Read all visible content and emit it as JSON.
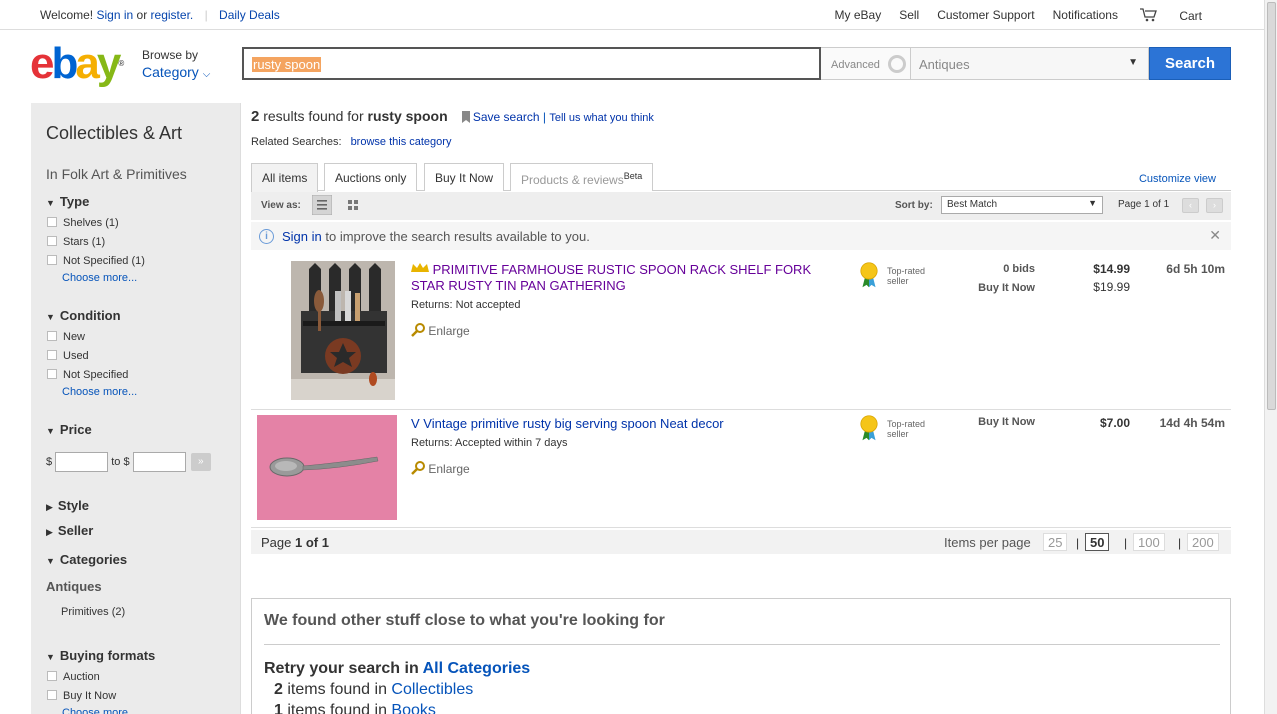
{
  "topbar": {
    "welcome": "Welcome!",
    "sign_in": "Sign in",
    "or": "or",
    "register": "register.",
    "daily_deals": "Daily Deals",
    "my_ebay": "My eBay",
    "sell": "Sell",
    "customer_support": "Customer Support",
    "notifications": "Notifications",
    "cart": "Cart"
  },
  "header": {
    "browse_by": "Browse by",
    "category": "Category",
    "search_value": "rusty spoon",
    "advanced": "Advanced",
    "category_select": "Antiques",
    "search_button": "Search"
  },
  "sidebar": {
    "title": "Collectibles & Art",
    "subtitle": "In Folk Art & Primitives",
    "type_header": "Type",
    "type_options": [
      "Shelves (1)",
      "Stars (1)",
      "Not Specified (1)"
    ],
    "choose_more": "Choose more...",
    "condition_header": "Condition",
    "condition_options": [
      "New",
      "Used",
      "Not Specified"
    ],
    "price_header": "Price",
    "price_currency": "$",
    "price_to": "to $",
    "style_header": "Style",
    "seller_header": "Seller",
    "categories_header": "Categories",
    "categories_top": "Antiques",
    "categories_sub": "Primitives  (2)",
    "buying_header": "Buying formats",
    "buying_options": [
      "Auction",
      "Buy It Now"
    ]
  },
  "results": {
    "count": "2",
    "found_for": "results found for",
    "query": "rusty spoon",
    "save_search": "Save search",
    "tell_us": "Tell us what you think",
    "related_label": "Related Searches:",
    "related_link": "browse this category"
  },
  "tabs": [
    "All items",
    "Auctions only",
    "Buy It Now",
    "Products & reviews"
  ],
  "tabs_beta": "Beta",
  "customize": "Customize view",
  "viewbar": {
    "view_as": "View as:",
    "sort_by": "Sort by:",
    "sort_value": "Best Match",
    "page_of": "Page 1 of 1"
  },
  "signin_bar": {
    "link": "Sign in",
    "text": "to improve the search results available to you."
  },
  "items": [
    {
      "title": "PRIMITIVE FARMHOUSE RUSTIC SPOON RACK SHELF FORK STAR RUSTY TIN PAN GATHERING",
      "returns": "Returns: Not accepted",
      "enlarge": "Enlarge",
      "badge": "Top-rated seller",
      "bids": "0 bids",
      "buy_it_now": "Buy It Now",
      "price": "$14.99",
      "bin_price": "$19.99",
      "time_left": "6d 5h 10m"
    },
    {
      "title": "V Vintage primitive rusty big serving spoon Neat decor",
      "returns": "Returns: Accepted within 7 days",
      "enlarge": "Enlarge",
      "badge": "Top-rated seller",
      "buy_it_now": "Buy It Now",
      "price": "$7.00",
      "time_left": "14d 4h 54m"
    }
  ],
  "pagebar": {
    "page": "Page",
    "page_num": "1 of 1",
    "items_per_page": "Items per page",
    "options": [
      "25",
      "50",
      "100",
      "200"
    ],
    "selected": "50"
  },
  "other": {
    "heading": "We found other stuff close to what you're looking for",
    "retry": "Retry your search in",
    "all_categories": "All Categories",
    "lines": [
      {
        "count": "2",
        "text": "items found in",
        "cat": "Collectibles"
      },
      {
        "count": "1",
        "text": "items found in",
        "cat": "Books"
      }
    ]
  },
  "colors": {
    "ebay_e": "#e53238",
    "ebay_b": "#0064d2",
    "ebay_a": "#f5af02",
    "ebay_y": "#86b817",
    "link": "#0654ba",
    "search_button": "#2c74d6",
    "item_title_1": "#660099"
  }
}
